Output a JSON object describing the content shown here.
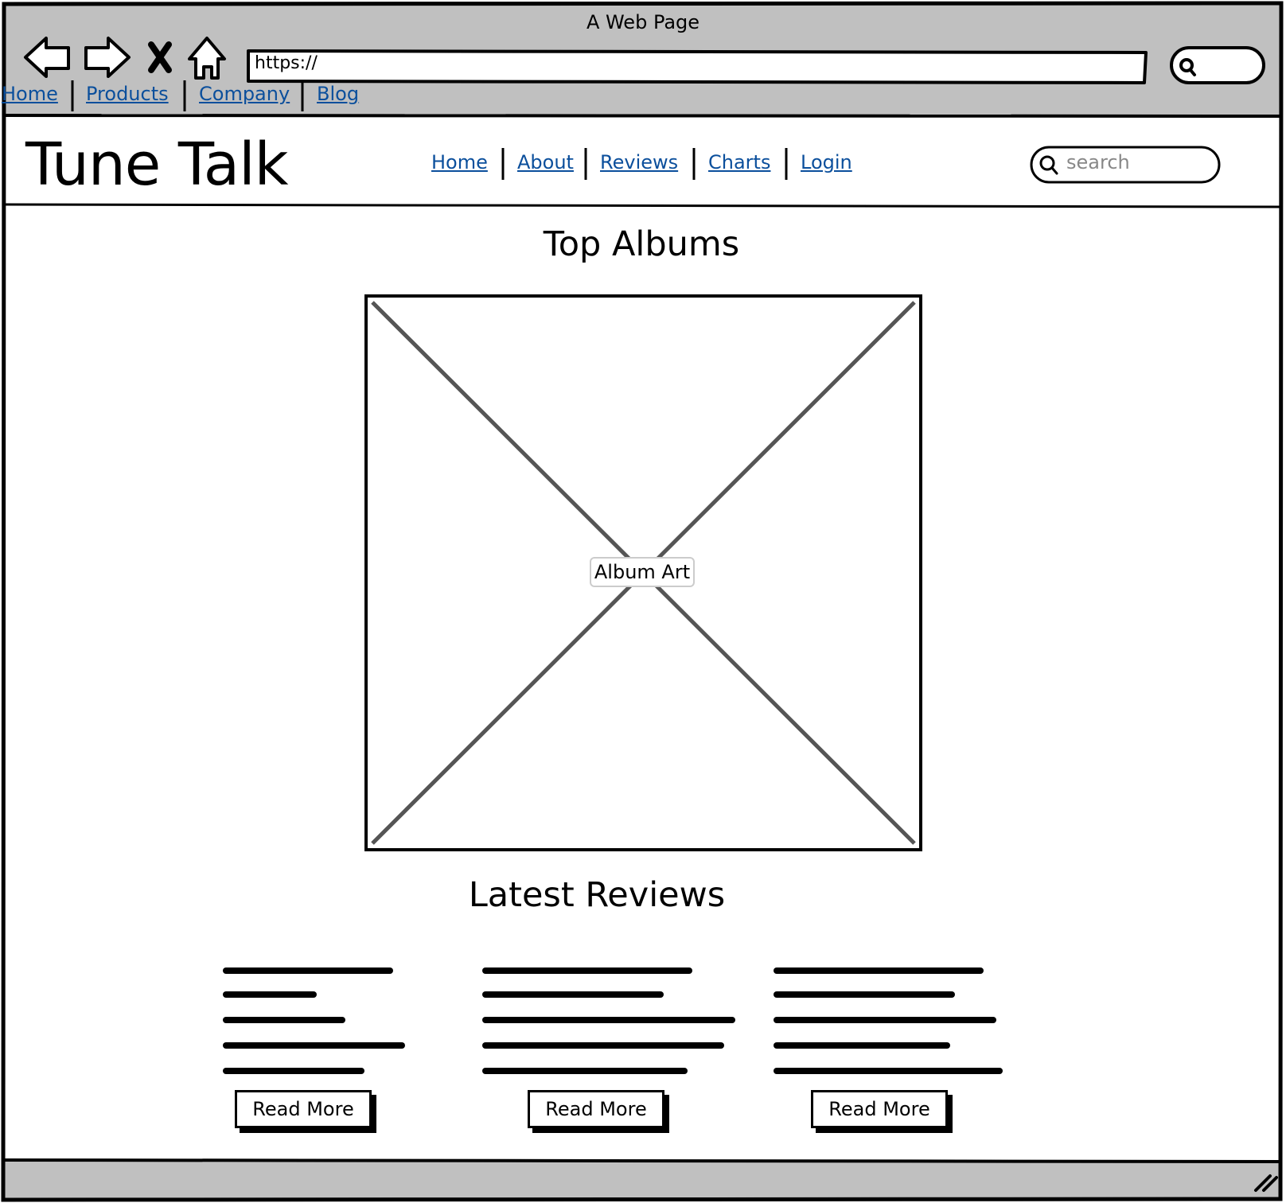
{
  "browser": {
    "window_title": "A Web Page",
    "url": "https://",
    "bookmarks": [
      "Home",
      "Products",
      "Company",
      "Blog"
    ]
  },
  "site": {
    "logo": "Tune Talk",
    "nav": [
      "Home",
      "About",
      "Reviews",
      "Charts",
      "Login"
    ],
    "search_placeholder": "search"
  },
  "main": {
    "top_albums_title": "Top Albums",
    "album_image_label": "Album Art",
    "latest_reviews_title": "Latest Reviews",
    "reviews": [
      {
        "button_label": "Read More"
      },
      {
        "button_label": "Read More"
      },
      {
        "button_label": "Read More"
      }
    ]
  },
  "colors": {
    "chrome_gray": "#c0c0c0",
    "link_blue": "#0b4f9c",
    "placeholder_line": "#555555"
  },
  "icons": [
    "back-arrow-icon",
    "forward-arrow-icon",
    "close-icon",
    "home-icon",
    "search-icon",
    "resize-grip-icon"
  ]
}
